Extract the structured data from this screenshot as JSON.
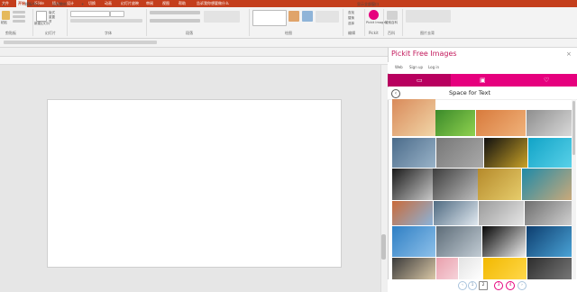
{
  "tabs": [
    "文件",
    "开始",
    "iSlide",
    "插入",
    "设计",
    "切换",
    "动画",
    "幻灯片放映",
    "审阅",
    "视图",
    "帮助",
    "告诉我你想要做什么"
  ],
  "ribbon_groups": [
    "剪贴板",
    "幻灯片",
    "字体",
    "段落",
    "绘图",
    "编辑",
    "Pickit",
    "百科",
    "图片去背"
  ],
  "ribbon_buttons": {
    "paste": "粘贴",
    "new_slide": "新建幻灯片",
    "layout": "版式",
    "reset": "重置",
    "section": "节",
    "find": "查找",
    "replace": "替换",
    "select": "选择",
    "pickit": "Pickit Images",
    "search": "搜索百科"
  },
  "doc_tabs": [
    "模板中心",
    "吉利教材"
  ],
  "display_hint": "显示全部窗口",
  "pane": {
    "title": "Pickit Free Images",
    "close": "×",
    "nav": [
      "Web",
      "Sign up",
      "Log in"
    ],
    "section_title": "Space for Text",
    "back_icon": "‹"
  },
  "pagination": [
    "‹",
    "1",
    "2",
    "3",
    "4",
    "›"
  ],
  "images": [
    {
      "name": "img-moon-dusk",
      "color": "#d98a5a",
      "color2": "#f1d6a8"
    },
    {
      "name": "img-green-leaf",
      "color": "#3b8a2a",
      "color2": "#8fd14f"
    },
    {
      "name": "img-orange-hands",
      "color": "#d87a3c",
      "color2": "#f0b27a"
    },
    {
      "name": "img-desk-gear",
      "color": "#8e8e8e",
      "color2": "#d9d9d9"
    },
    {
      "name": "img-cloud-sky",
      "color": "#4a6b8a",
      "color2": "#9ab3c8"
    },
    {
      "name": "img-gray-texture",
      "color": "#777777",
      "color2": "#aaaaaa"
    },
    {
      "name": "img-dark-lights",
      "color": "#101010",
      "color2": "#c9a227"
    },
    {
      "name": "img-teal-fabric",
      "color": "#11a3c7",
      "color2": "#59d1e8"
    },
    {
      "name": "img-silhouette",
      "color": "#1a1a1a",
      "color2": "#c8c8c8"
    },
    {
      "name": "img-bw-wave",
      "color": "#3d3d3d",
      "color2": "#bdbdbd"
    },
    {
      "name": "img-yellow-city",
      "color": "#b58a2b",
      "color2": "#e6cc6b"
    },
    {
      "name": "img-aerial-coast",
      "color": "#1e8aa8",
      "color2": "#caa97a"
    },
    {
      "name": "img-desert-dunes",
      "color": "#c96b3a",
      "color2": "#8bb3d9"
    },
    {
      "name": "img-wave-splash",
      "color": "#506b82",
      "color2": "#e0e8ef"
    },
    {
      "name": "img-sketch-lines",
      "color": "#9a9a9a",
      "color2": "#e5e5e5"
    },
    {
      "name": "img-bw-field",
      "color": "#6e6e6e",
      "color2": "#d0d0d0"
    },
    {
      "name": "img-jump-person",
      "color": "#2f7fc4",
      "color2": "#8ec1ea"
    },
    {
      "name": "img-city-skyline",
      "color": "#5d6c78",
      "color2": "#c2ccd4"
    },
    {
      "name": "img-light-trail",
      "color": "#050505",
      "color2": "#efefef"
    },
    {
      "name": "img-blue-wave",
      "color": "#0d3d6e",
      "color2": "#4aa3d6"
    },
    {
      "name": "img-crowd-lights",
      "color": "#3a3a3a",
      "color2": "#d9c7a6"
    },
    {
      "name": "img-pink-flowers",
      "color": "#e9a0ad",
      "color2": "#f6d2d9"
    },
    {
      "name": "img-white-cup",
      "color": "#e2e2e2",
      "color2": "#ffffff"
    },
    {
      "name": "img-yellow-wall",
      "color": "#f2b800",
      "color2": "#ffd84a"
    },
    {
      "name": "img-dark-room",
      "color": "#2d2d2d",
      "color2": "#777777"
    }
  ]
}
